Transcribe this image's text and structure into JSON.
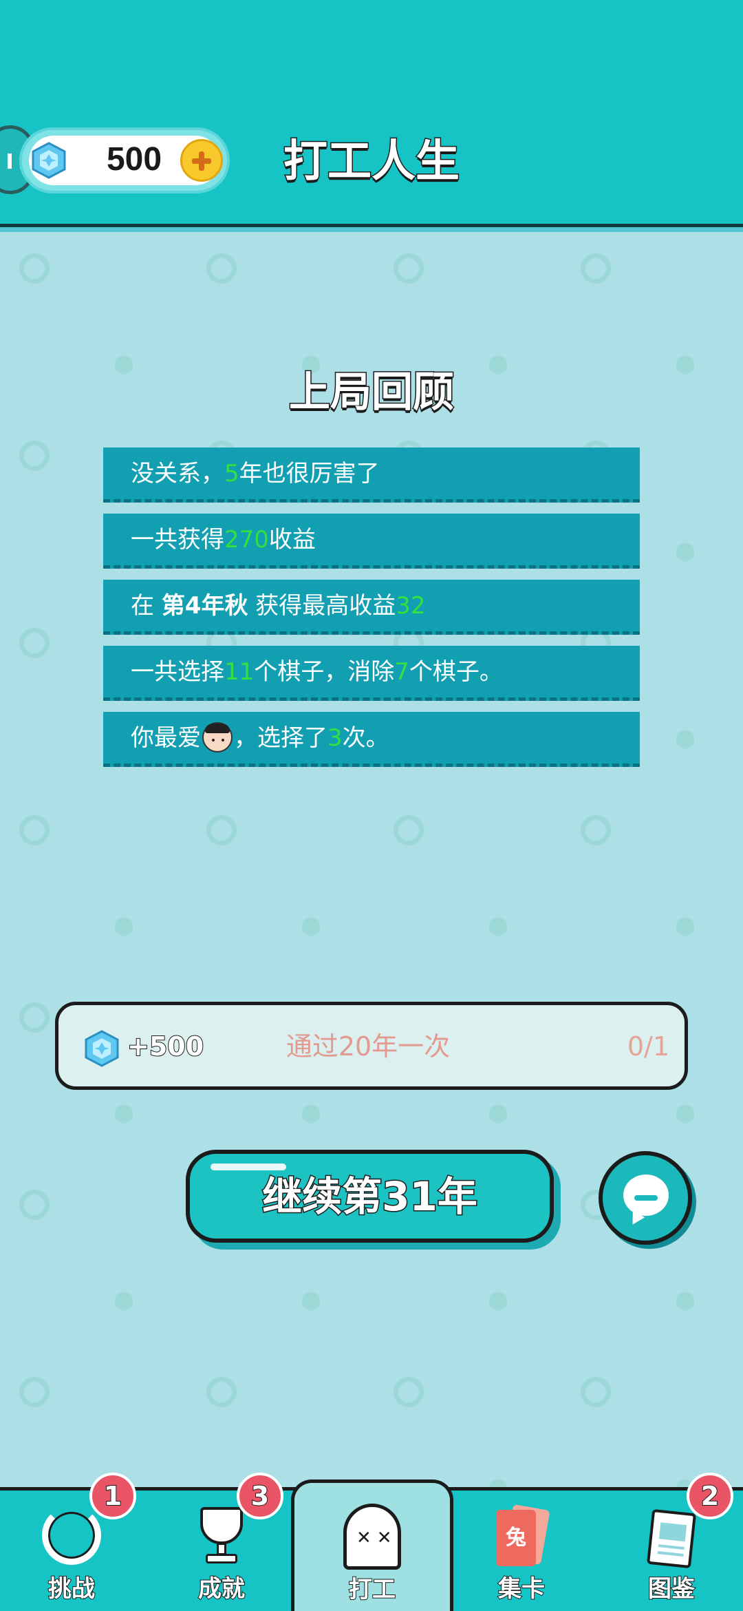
{
  "header": {
    "title": "打工人生",
    "diamonds": "500"
  },
  "review": {
    "title": "上局回顾",
    "rows": [
      {
        "pre": "没关系，",
        "hl": "5",
        "post": "年也很厉害了"
      },
      {
        "pre": "一共获得",
        "hl": "270",
        "post": "收益"
      },
      {
        "pre": "在 ",
        "bold": "第4年秋",
        "mid": " 获得最高收益",
        "hl": "32"
      },
      {
        "pre": "一共选择",
        "hl": "11",
        "mid": "个棋子，消除",
        "hl2": "7",
        "post": "个棋子。"
      },
      {
        "pre": "你最爱",
        "mid": "，选择了",
        "hl": "3",
        "post": "次。"
      }
    ]
  },
  "task": {
    "reward": "+500",
    "description": "通过20年一次",
    "progress": "0/1"
  },
  "continue_label": "继续第31年",
  "nav": {
    "items": [
      {
        "label": "挑战",
        "badge": "1"
      },
      {
        "label": "成就",
        "badge": "3"
      },
      {
        "label": "打工",
        "active": true
      },
      {
        "label": "集卡",
        "card_char": "兔"
      },
      {
        "label": "图鉴",
        "badge": "2"
      }
    ]
  },
  "colors": {
    "accent": "#17c4c5",
    "highlight": "#33e03f",
    "row_bg": "#139fb2",
    "badge": "#e95466"
  },
  "icons": {
    "diamond": "gem-icon",
    "add": "plus-icon",
    "chat": "chat-bubble-icon",
    "challenge": "ring-icon",
    "achievement": "trophy-icon",
    "work": "ghost-icon",
    "cards": "card-icon",
    "collection": "book-icon"
  }
}
